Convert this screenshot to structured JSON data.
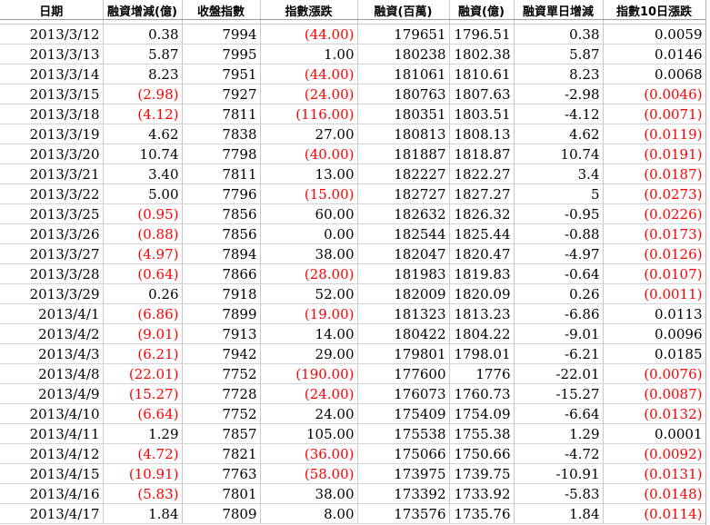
{
  "columns": [
    "日期",
    "融資增減(億)",
    "收盤指數",
    "指數漲跌",
    "融資(百萬)",
    "融資(億)",
    "融資單日增減",
    "指數10日漲跌"
  ],
  "rows": [
    {
      "date": "2013/3/12",
      "chg_yi": "0.38",
      "close": "7994",
      "idx_chg": "(44.00)",
      "bal_m": "179651",
      "bal_yi": "1796.51",
      "daily": "0.38",
      "idx10": "0.0059"
    },
    {
      "date": "2013/3/13",
      "chg_yi": "5.87",
      "close": "7995",
      "idx_chg": "1.00",
      "bal_m": "180238",
      "bal_yi": "1802.38",
      "daily": "5.87",
      "idx10": "0.0146"
    },
    {
      "date": "2013/3/14",
      "chg_yi": "8.23",
      "close": "7951",
      "idx_chg": "(44.00)",
      "bal_m": "181061",
      "bal_yi": "1810.61",
      "daily": "8.23",
      "idx10": "0.0068"
    },
    {
      "date": "2013/3/15",
      "chg_yi": "(2.98)",
      "close": "7927",
      "idx_chg": "(24.00)",
      "bal_m": "180763",
      "bal_yi": "1807.63",
      "daily": "-2.98",
      "idx10": "(0.0046)"
    },
    {
      "date": "2013/3/18",
      "chg_yi": "(4.12)",
      "close": "7811",
      "idx_chg": "(116.00)",
      "bal_m": "180351",
      "bal_yi": "1803.51",
      "daily": "-4.12",
      "idx10": "(0.0071)"
    },
    {
      "date": "2013/3/19",
      "chg_yi": "4.62",
      "close": "7838",
      "idx_chg": "27.00",
      "bal_m": "180813",
      "bal_yi": "1808.13",
      "daily": "4.62",
      "idx10": "(0.0119)"
    },
    {
      "date": "2013/3/20",
      "chg_yi": "10.74",
      "close": "7798",
      "idx_chg": "(40.00)",
      "bal_m": "181887",
      "bal_yi": "1818.87",
      "daily": "10.74",
      "idx10": "(0.0191)"
    },
    {
      "date": "2013/3/21",
      "chg_yi": "3.40",
      "close": "7811",
      "idx_chg": "13.00",
      "bal_m": "182227",
      "bal_yi": "1822.27",
      "daily": "3.4",
      "idx10": "(0.0187)"
    },
    {
      "date": "2013/3/22",
      "chg_yi": "5.00",
      "close": "7796",
      "idx_chg": "(15.00)",
      "bal_m": "182727",
      "bal_yi": "1827.27",
      "daily": "5",
      "idx10": "(0.0273)"
    },
    {
      "date": "2013/3/25",
      "chg_yi": "(0.95)",
      "close": "7856",
      "idx_chg": "60.00",
      "bal_m": "182632",
      "bal_yi": "1826.32",
      "daily": "-0.95",
      "idx10": "(0.0226)"
    },
    {
      "date": "2013/3/26",
      "chg_yi": "(0.88)",
      "close": "7856",
      "idx_chg": "0.00",
      "bal_m": "182544",
      "bal_yi": "1825.44",
      "daily": "-0.88",
      "idx10": "(0.0173)"
    },
    {
      "date": "2013/3/27",
      "chg_yi": "(4.97)",
      "close": "7894",
      "idx_chg": "38.00",
      "bal_m": "182047",
      "bal_yi": "1820.47",
      "daily": "-4.97",
      "idx10": "(0.0126)"
    },
    {
      "date": "2013/3/28",
      "chg_yi": "(0.64)",
      "close": "7866",
      "idx_chg": "(28.00)",
      "bal_m": "181983",
      "bal_yi": "1819.83",
      "daily": "-0.64",
      "idx10": "(0.0107)"
    },
    {
      "date": "2013/3/29",
      "chg_yi": "0.26",
      "close": "7918",
      "idx_chg": "52.00",
      "bal_m": "182009",
      "bal_yi": "1820.09",
      "daily": "0.26",
      "idx10": "(0.0011)"
    },
    {
      "date": "2013/4/1",
      "chg_yi": "(6.86)",
      "close": "7899",
      "idx_chg": "(19.00)",
      "bal_m": "181323",
      "bal_yi": "1813.23",
      "daily": "-6.86",
      "idx10": "0.0113"
    },
    {
      "date": "2013/4/2",
      "chg_yi": "(9.01)",
      "close": "7913",
      "idx_chg": "14.00",
      "bal_m": "180422",
      "bal_yi": "1804.22",
      "daily": "-9.01",
      "idx10": "0.0096"
    },
    {
      "date": "2013/4/3",
      "chg_yi": "(6.21)",
      "close": "7942",
      "idx_chg": "29.00",
      "bal_m": "179801",
      "bal_yi": "1798.01",
      "daily": "-6.21",
      "idx10": "0.0185"
    },
    {
      "date": "2013/4/8",
      "chg_yi": "(22.01)",
      "close": "7752",
      "idx_chg": "(190.00)",
      "bal_m": "177600",
      "bal_yi": "1776",
      "daily": "-22.01",
      "idx10": "(0.0076)"
    },
    {
      "date": "2013/4/9",
      "chg_yi": "(15.27)",
      "close": "7728",
      "idx_chg": "(24.00)",
      "bal_m": "176073",
      "bal_yi": "1760.73",
      "daily": "-15.27",
      "idx10": "(0.0087)"
    },
    {
      "date": "2013/4/10",
      "chg_yi": "(6.64)",
      "close": "7752",
      "idx_chg": "24.00",
      "bal_m": "175409",
      "bal_yi": "1754.09",
      "daily": "-6.64",
      "idx10": "(0.0132)"
    },
    {
      "date": "2013/4/11",
      "chg_yi": "1.29",
      "close": "7857",
      "idx_chg": "105.00",
      "bal_m": "175538",
      "bal_yi": "1755.38",
      "daily": "1.29",
      "idx10": "0.0001"
    },
    {
      "date": "2013/4/12",
      "chg_yi": "(4.72)",
      "close": "7821",
      "idx_chg": "(36.00)",
      "bal_m": "175066",
      "bal_yi": "1750.66",
      "daily": "-4.72",
      "idx10": "(0.0092)"
    },
    {
      "date": "2013/4/15",
      "chg_yi": "(10.91)",
      "close": "7763",
      "idx_chg": "(58.00)",
      "bal_m": "173975",
      "bal_yi": "1739.75",
      "daily": "-10.91",
      "idx10": "(0.0131)"
    },
    {
      "date": "2013/4/16",
      "chg_yi": "(5.83)",
      "close": "7801",
      "idx_chg": "38.00",
      "bal_m": "173392",
      "bal_yi": "1733.92",
      "daily": "-5.83",
      "idx10": "(0.0148)"
    },
    {
      "date": "2013/4/17",
      "chg_yi": "1.84",
      "close": "7809",
      "idx_chg": "8.00",
      "bal_m": "173576",
      "bal_yi": "1735.76",
      "daily": "1.84",
      "idx10": "(0.0114)"
    }
  ],
  "colors": {
    "negative": "#ff0000",
    "text": "#000000",
    "grid": "#c9c9c9"
  }
}
